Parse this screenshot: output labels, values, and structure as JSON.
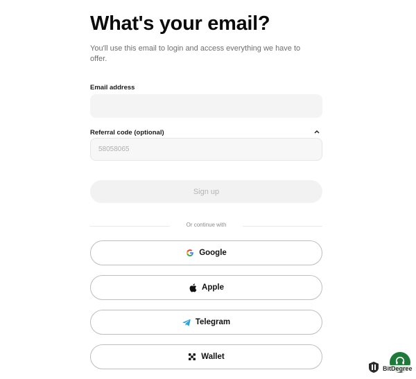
{
  "header": {
    "title": "What's your email?",
    "subtitle": "You'll use this email to login and access everything we have to offer."
  },
  "email": {
    "label": "Email address",
    "value": "",
    "placeholder": ""
  },
  "referral": {
    "label": "Referral code (optional)",
    "value": "58058065",
    "expanded": true
  },
  "signup": {
    "label": "Sign up",
    "enabled": false
  },
  "divider": {
    "text": "Or continue with"
  },
  "social": [
    {
      "label": "Google",
      "icon": "google-icon"
    },
    {
      "label": "Apple",
      "icon": "apple-icon"
    },
    {
      "label": "Telegram",
      "icon": "telegram-icon"
    },
    {
      "label": "Wallet",
      "icon": "wallet-icon"
    }
  ],
  "watermark": {
    "text": "BitDegree"
  },
  "colors": {
    "help_button": "#1e7a3a",
    "telegram": "#2aa3df",
    "input_bg": "#f4f4f4"
  }
}
